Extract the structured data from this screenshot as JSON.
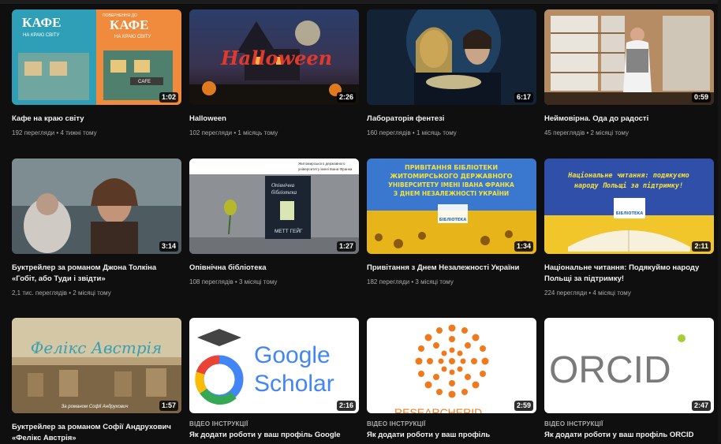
{
  "videos": [
    {
      "title": "Кафе на краю світу",
      "views": "192 перегляди",
      "age": "4 тижні тому",
      "duration": "1:02",
      "thumb_text": [
        "КАФЕ",
        "НА КРАЮ СВІТУ",
        "ПОВЕРНЕННЯ ДО",
        "КАФЕ",
        "НА КРАЮ СВІТУ",
        "CAFE"
      ]
    },
    {
      "title": "Halloween",
      "views": "102 перегляди",
      "age": "1 місяць тому",
      "duration": "2:26",
      "thumb_text": [
        "Halloween"
      ]
    },
    {
      "title": "Лабораторія фентезі",
      "views": "160 переглядів",
      "age": "1 місяць тому",
      "duration": "6:17"
    },
    {
      "title": "Неймовірна. Ода до радості",
      "views": "45 переглядів",
      "age": "2 місяці тому",
      "duration": "0:59"
    },
    {
      "title": "Буктрейлер за романом Джона Толкіна «Гобіт, або Туди і звідти»",
      "views": "2,1 тис. переглядів",
      "age": "2 місяці тому",
      "duration": "3:14"
    },
    {
      "title": "Опівнічна бібліотека",
      "views": "108 переглядів",
      "age": "3 місяці тому",
      "duration": "1:27",
      "thumb_text": [
        "Житомирського державного",
        "університету імені Івана Франка",
        "Опівнічна",
        "бібліотека",
        "МЕТТ ГЕЙГ"
      ]
    },
    {
      "title": "Привітання з Днем Незалежності України",
      "views": "182 перегляди",
      "age": "3 місяці тому",
      "duration": "1:34",
      "thumb_text": [
        "ПРИВІТАННЯ БІБЛІОТЕКИ",
        "ЖИТОМИРСЬКОГО ДЕРЖАВНОГО",
        "УНІВЕРСИТЕТУ ІМЕНІ ІВАНА ФРАНКА",
        "З ДНЕМ НЕЗАЛЕЖНОСТІ УКРАЇНИ",
        "БІБЛІОТЕКА"
      ]
    },
    {
      "title": "Національне читання: Подякуймо народу Польщі за підтримку!",
      "views": "224 перегляди",
      "age": "4 місяці тому",
      "duration": "2:11",
      "thumb_text": [
        "Національне читання: подякуємо",
        "народу Польщі за підтримку!",
        "БІБЛІОТЕКА"
      ]
    },
    {
      "title": "Буктрейлер за романом Софії Андрухович «Фелікс Австрія»",
      "duration": "1:57",
      "thumb_text": [
        "Фелікс Австрія",
        "За романом Софії Андрухович"
      ]
    },
    {
      "tag": "ВІДЕО ІНСТРУКЦІЇ",
      "title": "Як додати роботи у ваш профіль Google",
      "duration": "2:16",
      "thumb_text": [
        "Google",
        "Scholar"
      ]
    },
    {
      "tag": "ВІДЕО ІНСТРУКЦІЇ",
      "title": "Як додати роботи у ваш профіль",
      "duration": "2:59",
      "thumb_text": [
        "RESEARCHERID"
      ]
    },
    {
      "tag": "ВІДЕО ІНСТРУКЦІЇ",
      "title": "Як додати роботи у ваш профіль ORCID",
      "duration": "2:47",
      "thumb_text": [
        "ORCID"
      ]
    }
  ]
}
